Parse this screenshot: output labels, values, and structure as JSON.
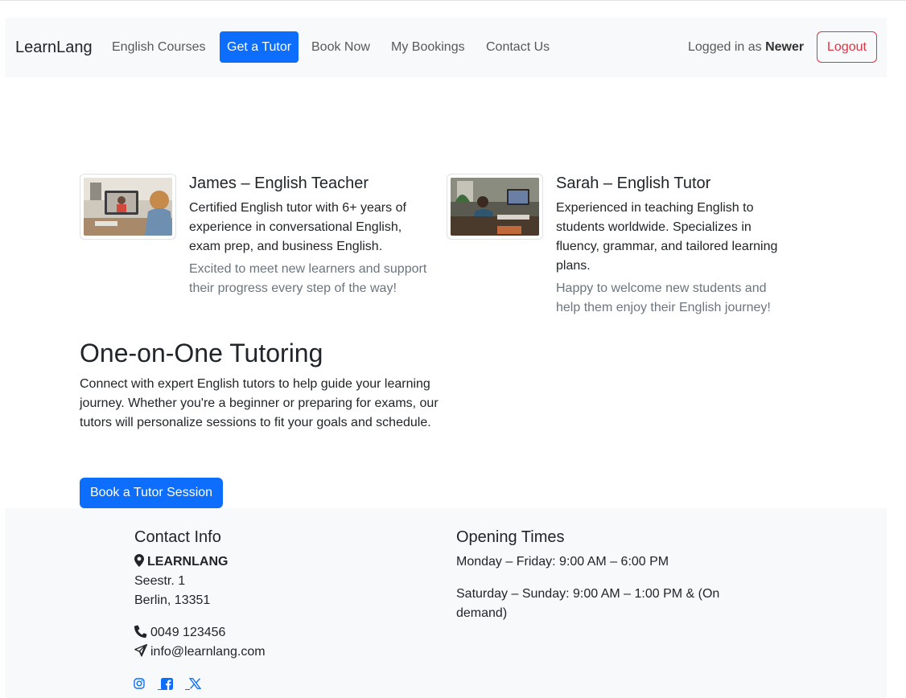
{
  "navbar": {
    "brand": "LearnLang",
    "links": [
      {
        "label": "English Courses"
      },
      {
        "label": "Get a Tutor"
      },
      {
        "label": "Book Now"
      },
      {
        "label": "My Bookings"
      },
      {
        "label": "Contact Us"
      }
    ],
    "active_link": "Get a Tutor",
    "logged_in_prefix": "Logged in as",
    "username": "Newer",
    "logout_label": "Logout"
  },
  "tutors": [
    {
      "name": "James – English Teacher",
      "description": "Certified English tutor with 6+ years of experience in conversational English, exam prep, and business English.",
      "note": "Excited to meet new learners and support their progress every step of the way!"
    },
    {
      "name": "Sarah – English Tutor",
      "description": "Experienced in teaching English to students worldwide. Specializes in fluency, grammar, and tailored learning plans.",
      "note": "Happy to welcome new students and help them enjoy their English journey!"
    }
  ],
  "hero": {
    "title": "One-on-One Tutoring",
    "text": "Connect with expert English tutors to help guide your learning journey. Whether you're a beginner or preparing for exams, our tutors will personalize sessions to fit your goals and schedule.",
    "button_label": "Book a Tutor Session"
  },
  "footer": {
    "contact_heading": "Contact Info",
    "company": "LEARNLANG",
    "street": "Seestr. 1",
    "city": "Berlin, 13351",
    "phone": "0049 123456",
    "email": "info@learnlang.com",
    "hours_heading": "Opening Times",
    "weekdays": "Monday – Friday: 9:00 AM – 6:00 PM",
    "weekend": "Saturday – Sunday: 9:00 AM – 1:00 PM & (On demand)",
    "social_icons": [
      "instagram-icon",
      "facebook-icon",
      "x-icon"
    ]
  },
  "colors": {
    "primary": "#0d6efd",
    "danger": "#dc3545",
    "light_bg": "#f8f9fa",
    "muted_text": "#6c757d"
  }
}
